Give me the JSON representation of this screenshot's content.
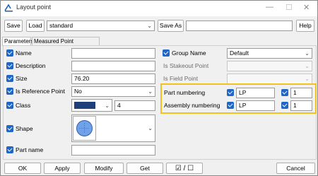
{
  "window": {
    "title": "Layout point"
  },
  "toolbar": {
    "save": "Save",
    "load": "Load",
    "preset": "standard",
    "save_as": "Save As",
    "save_as_name": "",
    "help": "Help"
  },
  "tabs": [
    {
      "label": "Parameters"
    },
    {
      "label": "Measured Point Parameters"
    }
  ],
  "left": {
    "name": {
      "label": "Name",
      "value": ""
    },
    "description": {
      "label": "Description",
      "value": ""
    },
    "size": {
      "label": "Size",
      "value": "76.20"
    },
    "is_reference_point": {
      "label": "Is Reference Point",
      "value": "No"
    },
    "class": {
      "label": "Class",
      "color": "#1f3f7a",
      "value": "4"
    },
    "shape": {
      "label": "Shape"
    },
    "part_name": {
      "label": "Part name",
      "value": ""
    }
  },
  "right": {
    "group_name": {
      "label": "Group Name",
      "value": "Default"
    },
    "is_stakeout_point": {
      "label": "Is Stakeout Point",
      "value": ""
    },
    "is_field_point": {
      "label": "Is Field Point",
      "value": ""
    },
    "part_numbering": {
      "label": "Part numbering",
      "prefix": "LP",
      "start": "1"
    },
    "assembly_numbering": {
      "label": "Assembly numbering",
      "prefix": "LP",
      "start": "1"
    }
  },
  "footer": {
    "ok": "OK",
    "apply": "Apply",
    "modify": "Modify",
    "get": "Get",
    "toggle": "☑ / ☐",
    "cancel": "Cancel"
  },
  "colors": {
    "accent": "#1e66c8",
    "highlight": "#f2c21e"
  }
}
